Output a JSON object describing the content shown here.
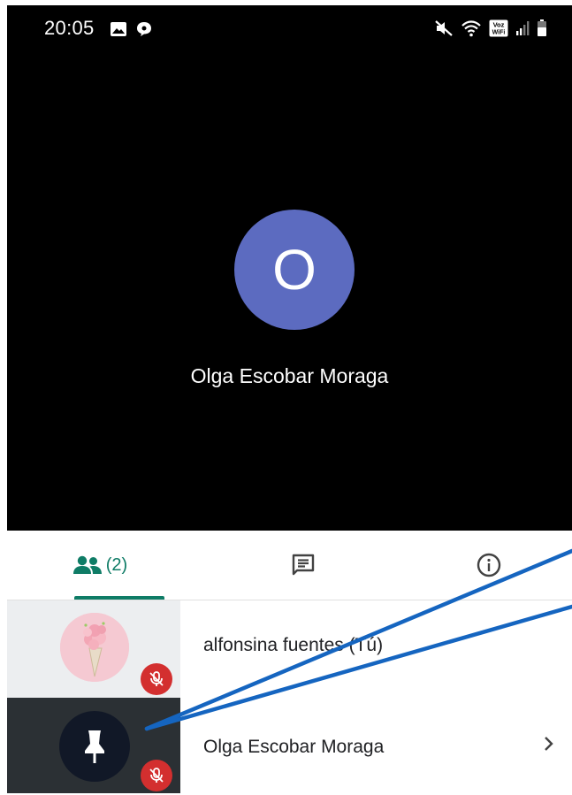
{
  "status_bar": {
    "time": "20:05",
    "left_icons": [
      "gallery-icon",
      "chat-bubble-icon"
    ],
    "right_icons": [
      "mute-icon",
      "wifi-icon",
      "voz-wifi-icon",
      "signal-icon",
      "battery-icon"
    ],
    "voz_wifi_line1": "Voz",
    "voz_wifi_line2": "WiFi"
  },
  "call": {
    "avatar_initial": "O",
    "participant_name": "Olga Escobar Moraga",
    "avatar_color": "#5c6bc0"
  },
  "tabs": {
    "people_count": "(2)",
    "accent_color": "#0f7c66",
    "items": [
      "people-icon",
      "chat-icon",
      "info-icon"
    ]
  },
  "participants": [
    {
      "name": "alfonsina fuentes (Tú)",
      "muted": true,
      "avatar": "ice-cream-photo"
    },
    {
      "name": "Olga Escobar Moraga",
      "muted": true,
      "avatar": "pin-icon"
    }
  ],
  "colors": {
    "mute_badge": "#d32f2f",
    "annotation_line": "#1565c0"
  }
}
